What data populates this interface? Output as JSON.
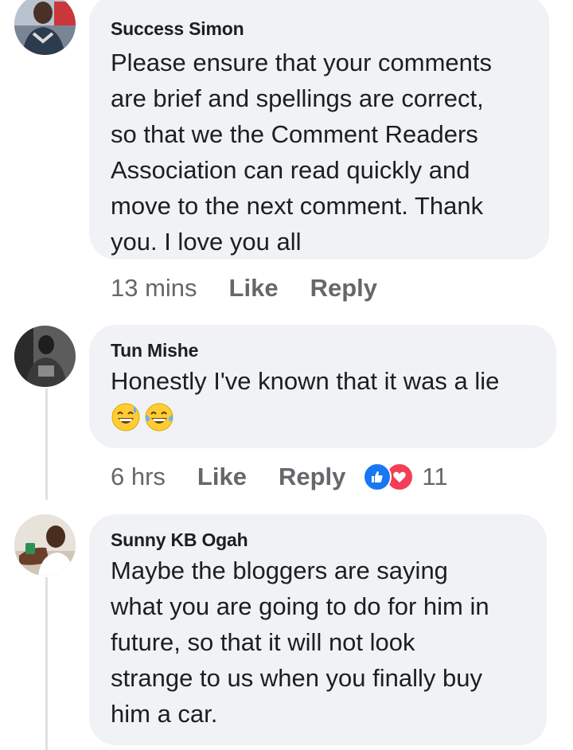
{
  "comments": [
    {
      "author": "Success Simon",
      "text": "Please ensure that your comments\nare brief and spellings are correct,\nso that we the Comment Readers\nAssociation can read quickly and\nmove to the next comment. Thank\nyou. I love you all",
      "time": "13 mins",
      "like_label": "Like",
      "reply_label": "Reply"
    },
    {
      "author": "Tun Mishe",
      "text": "Honestly I've known that it was a lie",
      "emojis": [
        "grinning-sweat-emoji",
        "tears-of-joy-emoji"
      ],
      "time": "6 hrs",
      "like_label": "Like",
      "reply_label": "Reply",
      "reactions": {
        "icons": [
          "like-icon",
          "love-icon"
        ],
        "count": "11"
      }
    },
    {
      "author": "Sunny KB Ogah",
      "text": "Maybe the bloggers are saying\nwhat you are going to do for him in\nfuture, so that it will not look\nstrange to us when you finally buy\nhim a car.",
      "time": "",
      "like_label": "",
      "reply_label": ""
    }
  ],
  "colors": {
    "bubble": "#f0f2f5",
    "meta_text": "#65676b",
    "like_blue": "#1877f2",
    "love_red": "#f33e58"
  }
}
